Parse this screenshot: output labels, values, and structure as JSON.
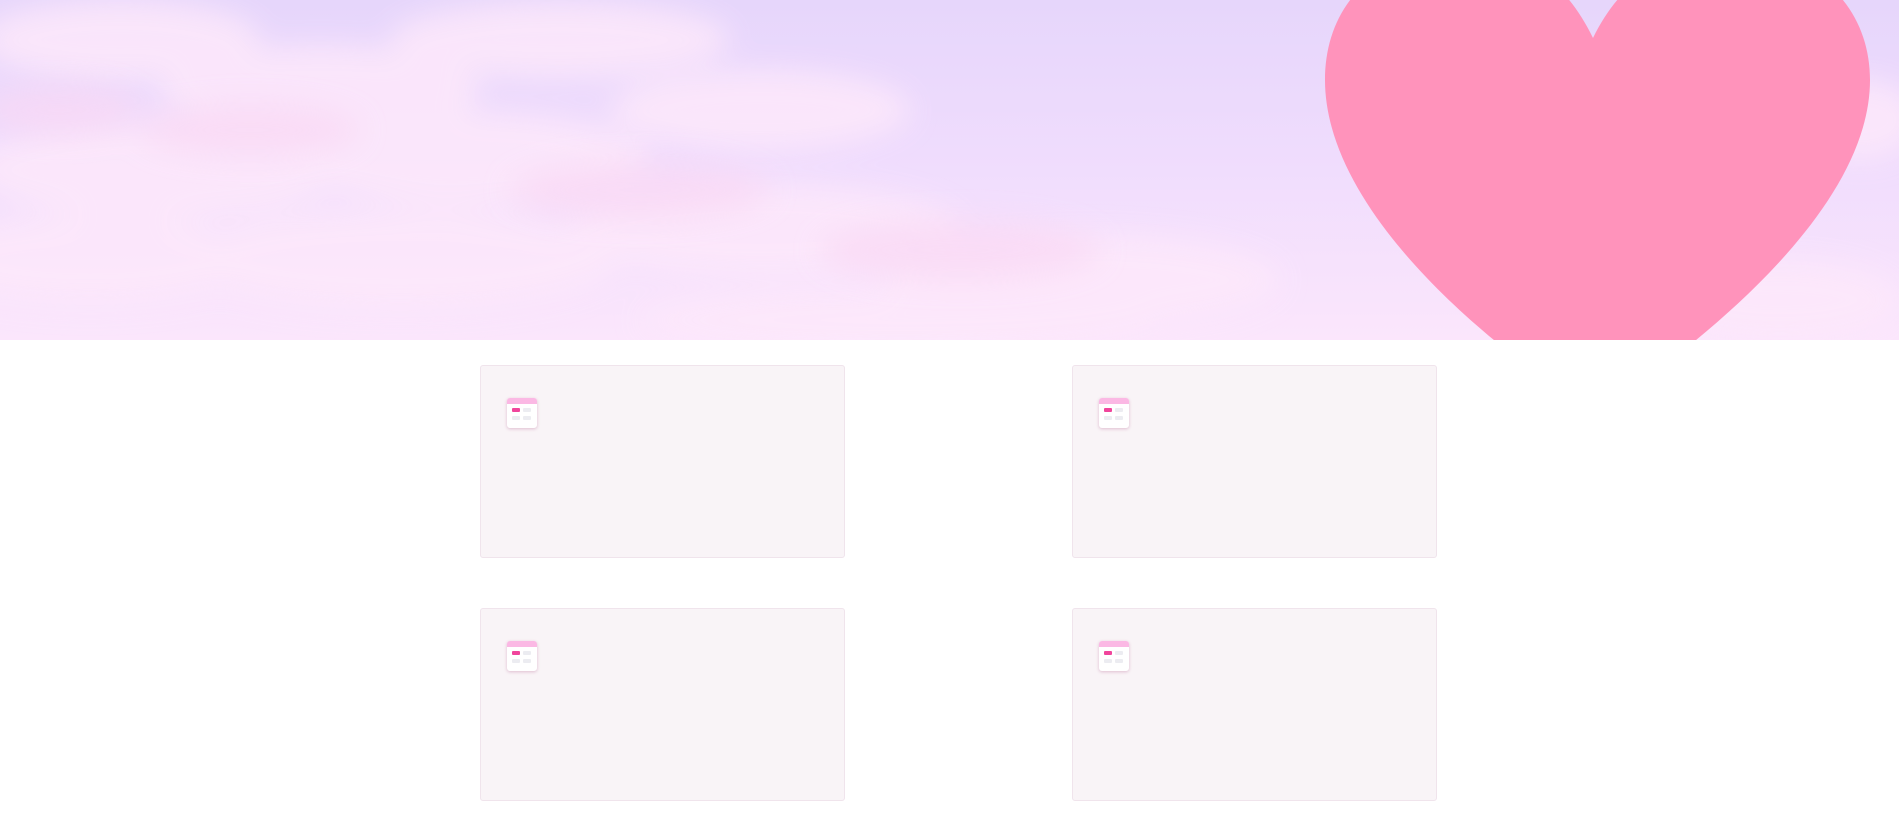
{
  "hero": {
    "background": "pastel-sky-with-clouds",
    "decoration": "heart-icon",
    "heart_color": "#ff93bb"
  },
  "cards": [
    {
      "icon": "calendar-icon",
      "accent_color": "#f0459c"
    },
    {
      "icon": "calendar-icon",
      "accent_color": "#f0459c"
    },
    {
      "icon": "calendar-icon",
      "accent_color": "#f0459c"
    },
    {
      "icon": "calendar-icon",
      "accent_color": "#f0459c"
    }
  ],
  "colors": {
    "card_background": "#f9f4f7",
    "icon_header": "#fbb8e4",
    "page_background": "#ffffff"
  }
}
